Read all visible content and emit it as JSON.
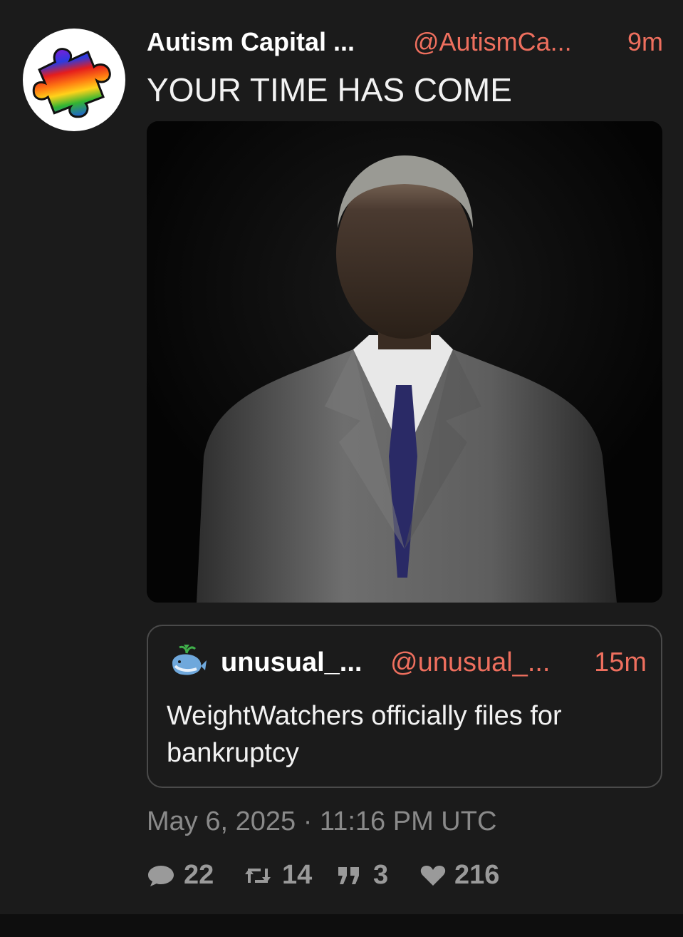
{
  "post": {
    "display_name": "Autism Capital ...",
    "handle": "@AutismCa...",
    "age": "9m",
    "text": "YOUR TIME HAS COME",
    "timestamp": "May 6, 2025 · 11:16 PM UTC",
    "avatar_icon": "rainbow-puzzle-piece-icon",
    "media_alt": "photo"
  },
  "quote": {
    "display_name": "unusual_...",
    "handle": "@unusual_...",
    "age": "15m",
    "text": "WeightWatchers officially files for bankruptcy",
    "avatar_icon": "whale-icon"
  },
  "stats": {
    "replies": "22",
    "reposts": "14",
    "quotes": "3",
    "likes": "216"
  },
  "colors": {
    "background": "#1b1b1b",
    "accent": "#ee6f5e",
    "muted": "#8a8a8a",
    "border": "#4a4a4a"
  }
}
